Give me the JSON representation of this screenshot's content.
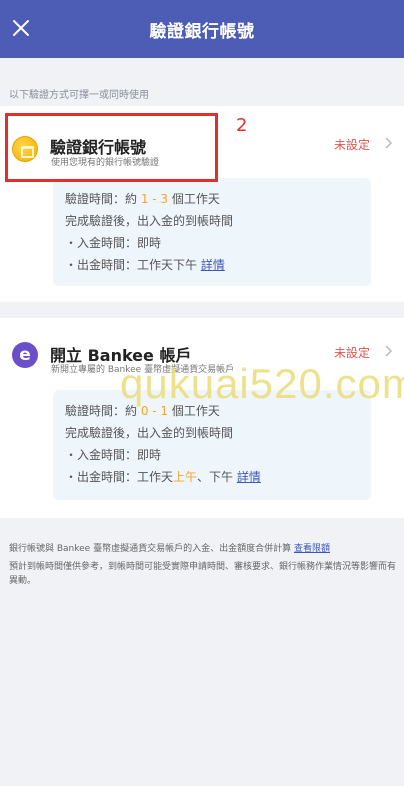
{
  "header": {
    "title": "驗證銀行帳號"
  },
  "hint": "以下驗證方式可擇一或同時使用",
  "bank_method": {
    "title": "驗證銀行帳號",
    "subtitle": "使用您現有的銀行帳號驗證",
    "status": "未設定",
    "time_prefix": "驗證時間：約 ",
    "time_range": "1 - 3",
    "time_suffix": " 個工作天",
    "after_verify": "完成驗證後，出入金的到帳時間",
    "deposit": "・入金時間：即時",
    "withdraw_prefix": "・出金時間：工作天下午 ",
    "detail_link": "詳情"
  },
  "bankee_method": {
    "title": "開立 Bankee 帳戶",
    "subtitle": "新開立專屬的 Bankee 臺幣虛擬通貨交易帳戶",
    "status": "未設定",
    "time_prefix": "驗證時間：約 ",
    "time_range": "0 - 1",
    "time_suffix": " 個工作天",
    "after_verify": "完成驗證後，出入金的到帳時間",
    "deposit": "・入金時間：即時",
    "withdraw_prefix": "・出金時間：工作天",
    "withdraw_accent": "上午",
    "withdraw_suffix": "、下午 ",
    "detail_link": "詳情"
  },
  "footer": {
    "note1": "銀行帳號與 Bankee 臺幣虛擬通貨交易帳戶的入金、出金額度合併計算 ",
    "note1_link": "查看限額",
    "note2": "預計到帳時間僅供參考，到帳時間可能受實際申請時間、審核要求、銀行帳務作業情況等影響而有異動。"
  },
  "annotation": {
    "step": "2"
  },
  "watermark": "qukuai520.com",
  "colors": {
    "header": "#4d5cb4",
    "status": "#e0554f",
    "accent": "#f2a52b",
    "link": "#3d57b8",
    "annotation": "#e0302c"
  }
}
